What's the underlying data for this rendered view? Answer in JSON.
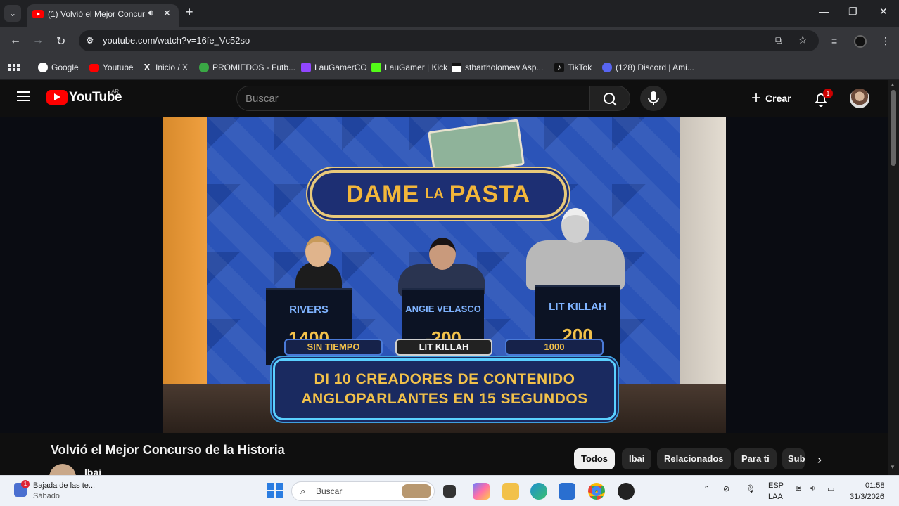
{
  "browser": {
    "tab": {
      "title": "(1) Volvió el Mejor Concurso",
      "audio_icon": "speaker-icon",
      "close_glyph": "✕"
    },
    "new_tab_glyph": "+",
    "window_controls": {
      "minimize": "—",
      "maximize": "❐",
      "close": "✕"
    },
    "url": "youtube.com/watch?v=16fe_Vc52so",
    "bookmarks": [
      {
        "label": "Google",
        "icon": "google-icon",
        "color": "#4285f4"
      },
      {
        "label": "Youtube",
        "icon": "youtube-icon",
        "color": "#ff0000"
      },
      {
        "label": "Inicio / X",
        "icon": "x-icon",
        "color": "#000000"
      },
      {
        "label": "PROMIEDOS - Futb...",
        "icon": "promiedos-icon",
        "color": "#3aa845"
      },
      {
        "label": "LauGamerCO",
        "icon": "twitch-icon",
        "color": "#9146ff"
      },
      {
        "label": "LauGamer | Kick",
        "icon": "kick-icon",
        "color": "#53fc18"
      },
      {
        "label": "stbartholomew Asp...",
        "icon": "aspx-icon",
        "color": "#1a1a1a"
      },
      {
        "label": "TikTok",
        "icon": "tiktok-icon",
        "color": "#111111"
      },
      {
        "label": "(128) Discord | Ami...",
        "icon": "discord-icon",
        "color": "#5865f2"
      }
    ]
  },
  "youtube": {
    "logo_text": "YouTube",
    "country_code": "AR",
    "search_placeholder": "Buscar",
    "create_label": "Crear",
    "notification_count": "1",
    "video": {
      "show_logo_big_1": "DAME",
      "show_logo_small": "LA",
      "show_logo_big_2": "PASTA",
      "podiums": [
        {
          "name": "RIVERS",
          "score": "1400"
        },
        {
          "name": "ANGIE VELASCO",
          "score": "-200"
        },
        {
          "name": "LIT KILLAH",
          "score": "200"
        }
      ],
      "pills": [
        "SIN TIEMPO",
        "LIT KILLAH",
        "1000"
      ],
      "question_line_1": "DI 10 CREADORES DE CONTENIDO",
      "question_line_2": "ANGLOPARLANTES EN 15 SEGUNDOS"
    },
    "title": "Volvió el Mejor Concurso de la Historia",
    "channel_name": "Ibai",
    "chips": [
      "Todos",
      "Ibai",
      "Relacionados",
      "Para ti",
      "Sub"
    ]
  },
  "taskbar": {
    "weather_badge": "1",
    "weather_title": "Bajada de las te...",
    "weather_sub": "Sábado",
    "search_label": "Buscar",
    "lang_1": "ESP",
    "lang_2": "LAA",
    "time": "01:58",
    "date": "31/3/2026"
  }
}
